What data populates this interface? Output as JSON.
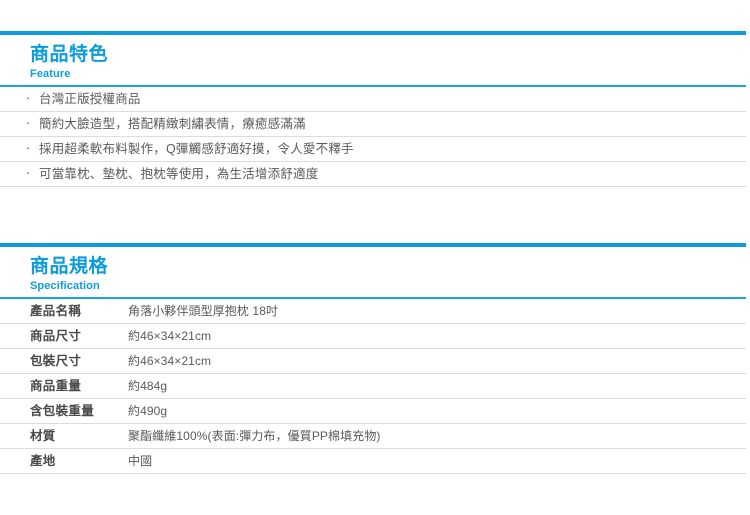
{
  "colors": {
    "accent_blue": "#0d9bdc",
    "underline_blue": "#1ba5e0",
    "rule_gray": "#dcdcdc",
    "body_text": "#5a5a5a",
    "label_text": "#4a4a4a"
  },
  "feature_section": {
    "title_cn": "商品特色",
    "title_en": "Feature",
    "bullet_glyph": "‧",
    "items": [
      {
        "text": "台灣正版授權商品"
      },
      {
        "text": "簡約大臉造型，搭配精緻刺繡表情，療癒感滿滿"
      },
      {
        "text": "採用超柔軟布料製作，Q彈觸感舒適好摸，令人愛不釋手"
      },
      {
        "text": "可當靠枕、墊枕、抱枕等使用，為生活增添舒適度"
      }
    ]
  },
  "spec_section": {
    "title_cn": "商品規格",
    "title_en": "Specification",
    "rows": [
      {
        "label": "產品名稱",
        "value": "角落小夥伴頭型厚抱枕 18吋"
      },
      {
        "label": "商品尺寸",
        "value": "約46×34×21cm"
      },
      {
        "label": "包裝尺寸",
        "value": "約46×34×21cm"
      },
      {
        "label": "商品重量",
        "value": "約484g"
      },
      {
        "label": "含包裝重量",
        "value": "約490g"
      },
      {
        "label": "材質",
        "value": "聚酯纖維100%(表面:彈力布，優質PP棉填充物)"
      },
      {
        "label": "產地",
        "value": "中國"
      }
    ]
  }
}
